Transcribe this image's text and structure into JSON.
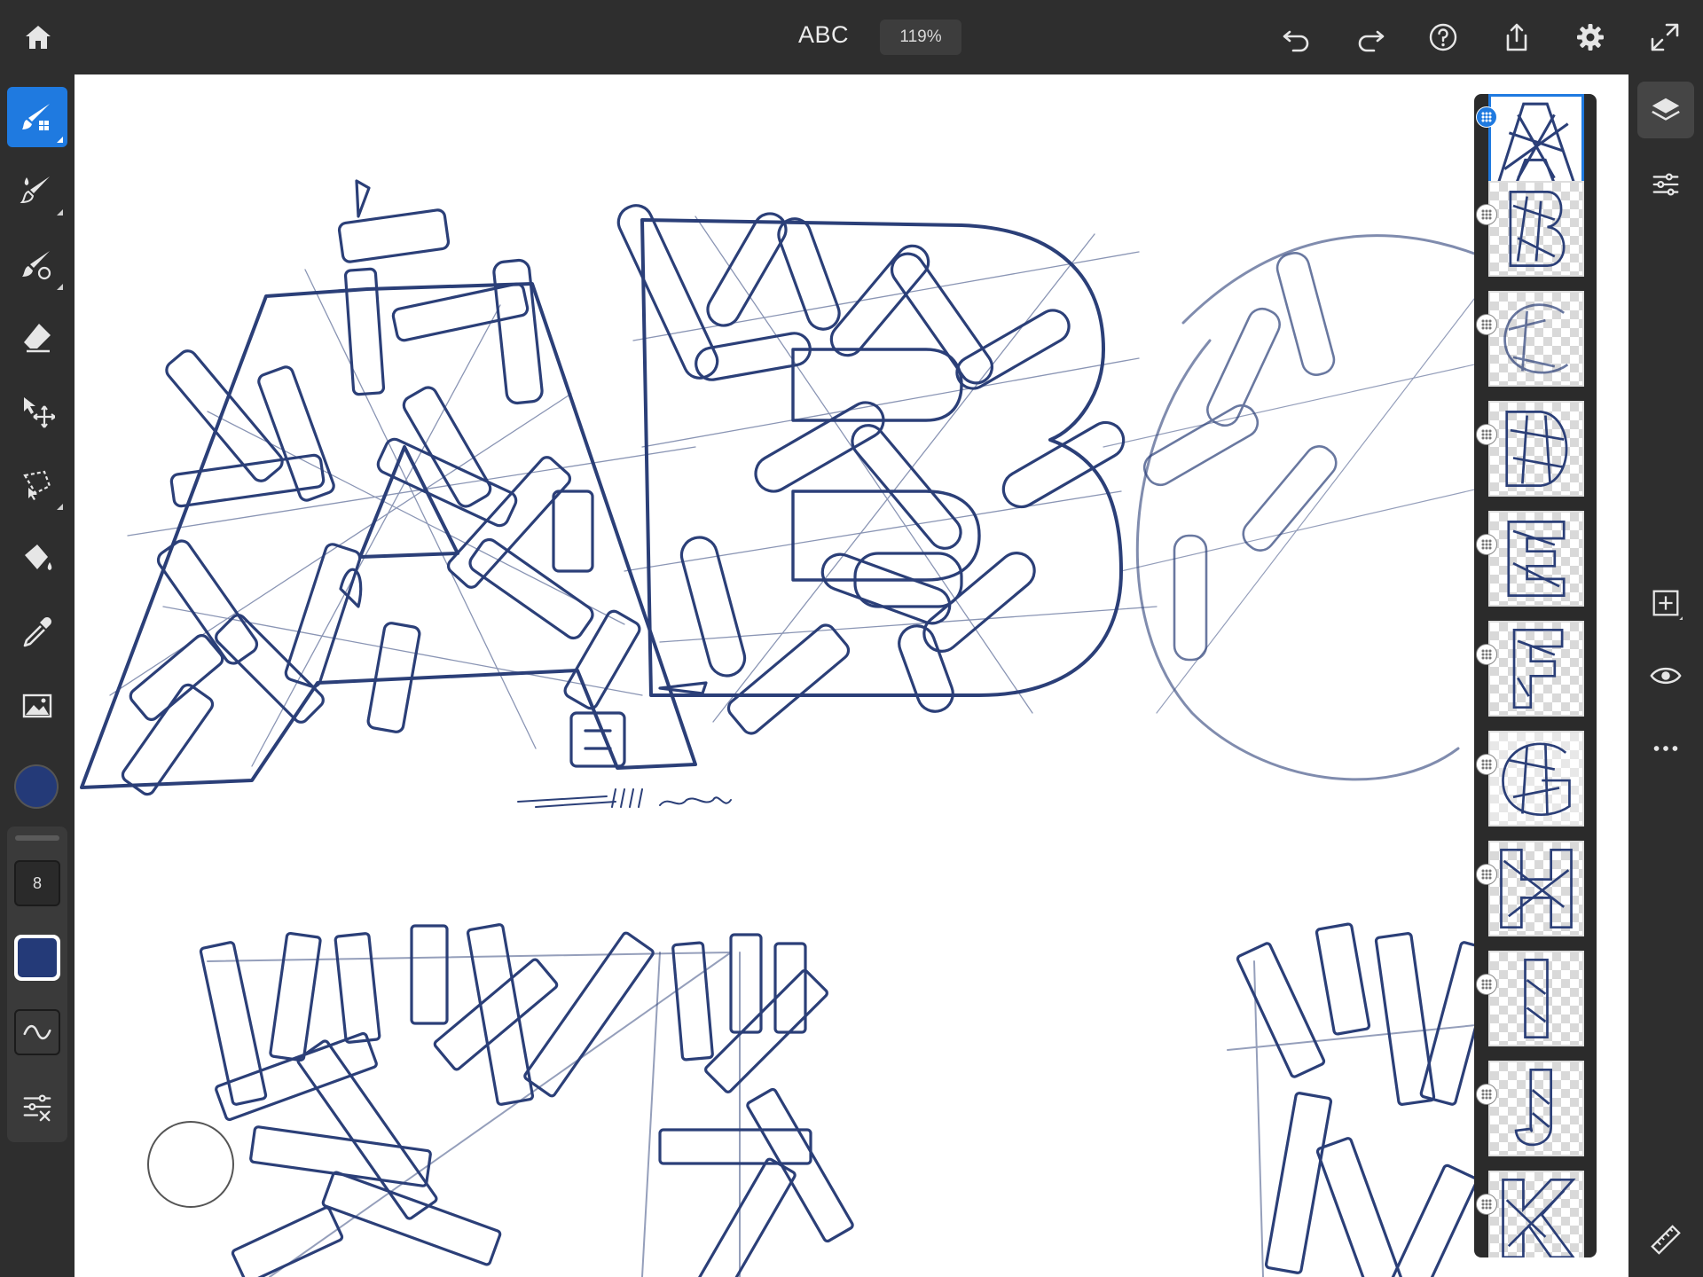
{
  "header": {
    "title": "ABC",
    "zoom": "119%"
  },
  "tools": [
    {
      "name": "pixel-brush",
      "active": true
    },
    {
      "name": "live-brush",
      "active": false
    },
    {
      "name": "mixer-brush",
      "active": false
    },
    {
      "name": "eraser",
      "active": false
    },
    {
      "name": "transform",
      "active": false
    },
    {
      "name": "lasso-select",
      "active": false
    },
    {
      "name": "fill",
      "active": false
    },
    {
      "name": "eyedropper",
      "active": false
    },
    {
      "name": "place-image",
      "active": false
    }
  ],
  "brush": {
    "size": "8",
    "color": "#243a78"
  },
  "colors": {
    "accent": "#1f7ae0",
    "ink": "#2b3f78"
  },
  "layers": {
    "count": 11,
    "selected_index": 0,
    "letters": [
      "A",
      "B",
      "C",
      "D",
      "E",
      "F",
      "G",
      "H",
      "I",
      "J",
      "K"
    ]
  },
  "right_tools": [
    "layers-icon",
    "layer-properties-icon",
    "add-layer-icon",
    "visibility-icon",
    "more-icon",
    "ruler-icon"
  ]
}
